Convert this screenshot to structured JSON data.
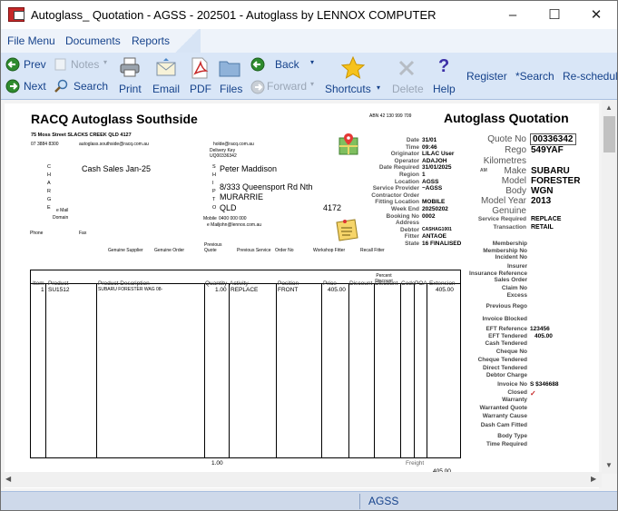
{
  "window": {
    "title": "Autoglass_ Quotation - AGSS - 202501 - Autoglass by LENNOX COMPUTER",
    "minimize": "–",
    "maximize": "☐",
    "close": "✕"
  },
  "menu": [
    "File Menu",
    "Documents",
    "Reports"
  ],
  "toolbar": {
    "prev": "Prev",
    "next": "Next",
    "notes": "Notes",
    "search": "Search",
    "print": "Print",
    "email": "Email",
    "pdf": "PDF",
    "files": "Files",
    "back": "Back",
    "forward": "Forward",
    "shortcuts": "Shortcuts",
    "delete": "Delete",
    "help": "Help",
    "register": "Register",
    "star_search": "*Search",
    "reschedule": "Re-schedule"
  },
  "doc": {
    "company": "RACQ Autoglass Southside",
    "abn": "ABN 42 130 999 709",
    "doc_title": "Autoglass Quotation",
    "address": "75 Moss Street SLACKS CREEK QLD 4127",
    "phone": "07 3884 8300",
    "email": "autoglass.southside@racq.com.au",
    "charge_vertical": "C H A R G E",
    "charge_name": "Cash Sales Jan-25",
    "email_mail": "e Mail",
    "domain": "Domain",
    "phone_lbl": "Phone",
    "fax_lbl": "Fax",
    "holder_email": "holde@racq.com.au",
    "delivery_key": "Delivery Key",
    "delivery_code": "UQ00336342",
    "ship_vertical": "S H I P",
    "to_vertical": "T O",
    "ship_name": "Peter Maddison",
    "ship_addr1": "8/333 Queensport Rd Nth",
    "ship_addr2": "MURARRIE",
    "ship_state": "QLD",
    "ship_post": "4172",
    "mobile_lbl": "Mobile",
    "mobile": "0400 000 000",
    "ship_mail_lbl": "e Mail",
    "ship_mail": "john@lennox.com.au",
    "supplier_row": [
      "Genuine Supplier",
      "Genuine Order",
      "Previous Quote",
      "Previous Service",
      "Order No",
      "Workshop Fitter",
      "Recall Fitter"
    ]
  },
  "details": [
    {
      "label": "Date",
      "value": "31/01"
    },
    {
      "label": "Time",
      "value": "09:46"
    },
    {
      "label": "Originator",
      "value": "LILAC User"
    },
    {
      "label": "Operator",
      "value": "ADAJOH"
    },
    {
      "label": "Date Required",
      "value": "31/01/2025"
    },
    {
      "label": "Region",
      "value": "1"
    },
    {
      "label": "Location",
      "value": "AGSS"
    },
    {
      "label": "Service Provider",
      "value": "~AGSS"
    },
    {
      "label": "Contractor Order",
      "value": ""
    },
    {
      "label": "Fitting Location",
      "value": "MOBILE"
    },
    {
      "label": "Week End",
      "value": "20250202"
    },
    {
      "label": "Booking No",
      "value": "0002"
    },
    {
      "label": "Address",
      "value": ""
    },
    {
      "label": "Debtor",
      "value": "CASHAG1001"
    },
    {
      "label": "Fitter",
      "value": "ANTAOE"
    },
    {
      "label": "State",
      "value": "16   FINALISED"
    }
  ],
  "vehicle": {
    "quote_lbl": "Quote No",
    "quote_no": "00336342",
    "rego_lbl": "Rego",
    "rego": "549YAF",
    "km_lbl": "Kilometres",
    "am": "AM",
    "make_lbl": "Make",
    "make": "SUBARU",
    "model_lbl": "Model",
    "model": "FORESTER",
    "body_lbl": "Body",
    "body": "WGN",
    "year_lbl": "Model Year",
    "year": "2013",
    "genuine_lbl": "Genuine",
    "service_req_lbl": "Service Required",
    "service_req": "REPLACE",
    "transaction_lbl": "Transaction",
    "transaction": "RETAIL"
  },
  "right_fields": [
    {
      "label": "Membership",
      "value": ""
    },
    {
      "label": "Membership No",
      "value": ""
    },
    {
      "label": "Incident No",
      "value": ""
    },
    {
      "label": "Insurer",
      "value": ""
    },
    {
      "label": "Insurance Reference",
      "value": ""
    },
    {
      "label": "Sales Order",
      "value": ""
    },
    {
      "label": "Claim No",
      "value": ""
    },
    {
      "label": "Excess",
      "value": ""
    },
    {
      "label": "Previous Rego",
      "value": ""
    },
    {
      "label": "Invoice Blocked",
      "value": ""
    },
    {
      "label": "EFT Reference",
      "value": "123456"
    },
    {
      "label": "EFT Tendered",
      "value": "405.00"
    },
    {
      "label": "Cash Tendered",
      "value": ""
    },
    {
      "label": "Cheque No",
      "value": ""
    },
    {
      "label": "Cheque Tendered",
      "value": ""
    },
    {
      "label": "Direct Tendered",
      "value": ""
    },
    {
      "label": "Debtor Charge",
      "value": ""
    },
    {
      "label": "Invoice No",
      "value": "S $346688"
    },
    {
      "label": "Closed",
      "value": "✓"
    },
    {
      "label": "Warranty",
      "value": ""
    },
    {
      "label": "Warranted Quote",
      "value": ""
    },
    {
      "label": "Warranty Cause",
      "value": ""
    },
    {
      "label": "Dash Cam Fitted",
      "value": ""
    },
    {
      "label": "Body Type",
      "value": ""
    },
    {
      "label": "Time Required",
      "value": ""
    }
  ],
  "grid": {
    "percent_discount": "Percent Discount",
    "headers": [
      "Item",
      "Product",
      "Product Description",
      "Quantity",
      "Activity",
      "Position",
      "Price",
      "Discount",
      "Discount",
      "Code",
      "POA",
      "Extension"
    ],
    "rows": [
      [
        "1",
        "SU1512",
        "SUBARU FORESTER WAG 08-",
        "1.00",
        "REPLACE",
        "FRONT",
        "405.00",
        "",
        "",
        "",
        "",
        "405.00"
      ]
    ],
    "total_qty": "1.00",
    "freight_lbl": "Freight",
    "total": "405.00"
  },
  "status": {
    "text": "AGSS"
  }
}
